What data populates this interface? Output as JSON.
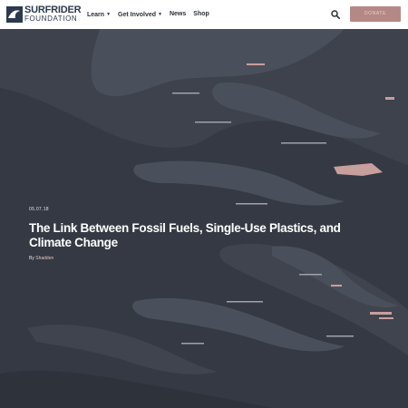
{
  "header": {
    "logo": {
      "line1": "SURFRIDER",
      "line2": "FOUNDATION"
    },
    "nav": [
      {
        "label": "Learn",
        "has_dropdown": true
      },
      {
        "label": "Get Involved",
        "has_dropdown": true
      },
      {
        "label": "News",
        "has_dropdown": false
      },
      {
        "label": "Shop",
        "has_dropdown": false
      }
    ],
    "caret_glyph": "▼",
    "search_icon": "search-icon",
    "donate_label": "DONATE"
  },
  "hero": {
    "date": "05.07.18",
    "title": "The Link Between Fossil Fuels, Single-Use Plastics, and Climate Change",
    "byline_prefix": "By",
    "author": "Shadden"
  },
  "colors": {
    "brand_navy": "#2b3a4e",
    "donate_bg": "#b58886",
    "hero_dark": "#343943",
    "hero_light": "#4a505b",
    "accent_pink": "#c79f9c"
  }
}
